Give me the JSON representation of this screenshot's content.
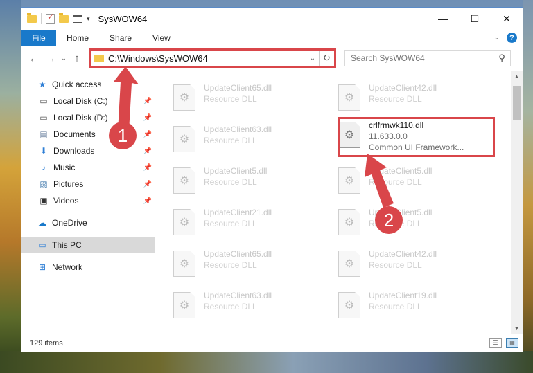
{
  "window": {
    "title": "SysWOW64"
  },
  "ribbon": {
    "tabs": [
      "File",
      "Home",
      "Share",
      "View"
    ],
    "help": "?"
  },
  "nav": {
    "address": "C:\\Windows\\SysWOW64",
    "search_placeholder": "Search SysWOW64"
  },
  "sidebar": {
    "quick_access": "Quick access",
    "items": [
      {
        "label": "Local Disk (C:)",
        "icon": "drive-icon"
      },
      {
        "label": "Local Disk (D:)",
        "icon": "drive-icon"
      },
      {
        "label": "Documents",
        "icon": "documents-icon"
      },
      {
        "label": "Downloads",
        "icon": "downloads-icon"
      },
      {
        "label": "Music",
        "icon": "music-icon"
      },
      {
        "label": "Pictures",
        "icon": "pictures-icon"
      },
      {
        "label": "Videos",
        "icon": "videos-icon"
      }
    ],
    "onedrive": "OneDrive",
    "thispc": "This PC",
    "network": "Network"
  },
  "files": [
    {
      "name": "UpdateClient65.dll",
      "desc": "Resource DLL"
    },
    {
      "name": "UpdateClient42.dll",
      "desc": "Resource DLL"
    },
    {
      "name": "UpdateClient63.dll",
      "desc": "Resource DLL"
    },
    {
      "name": "crlfrmwk110.dll",
      "version": "11.633.0.0",
      "desc": "Common UI Framework..."
    },
    {
      "name": "UpdateClient5.dll",
      "desc": "Resource DLL"
    },
    {
      "name": "UpdateClient5.dll",
      "desc": "Resource DLL"
    },
    {
      "name": "UpdateClient21.dll",
      "desc": "Resource DLL"
    },
    {
      "name": "UpdateClient5.dll",
      "desc": "Resource DLL"
    },
    {
      "name": "UpdateClient65.dll",
      "desc": "Resource DLL"
    },
    {
      "name": "UpdateClient42.dll",
      "desc": "Resource DLL"
    },
    {
      "name": "UpdateClient63.dll",
      "desc": "Resource DLL"
    },
    {
      "name": "UpdateClient19.dll",
      "desc": "Resource DLL"
    }
  ],
  "status": {
    "items": "129 items"
  },
  "callouts": {
    "one": "1",
    "two": "2",
    "color": "#d9464a"
  }
}
